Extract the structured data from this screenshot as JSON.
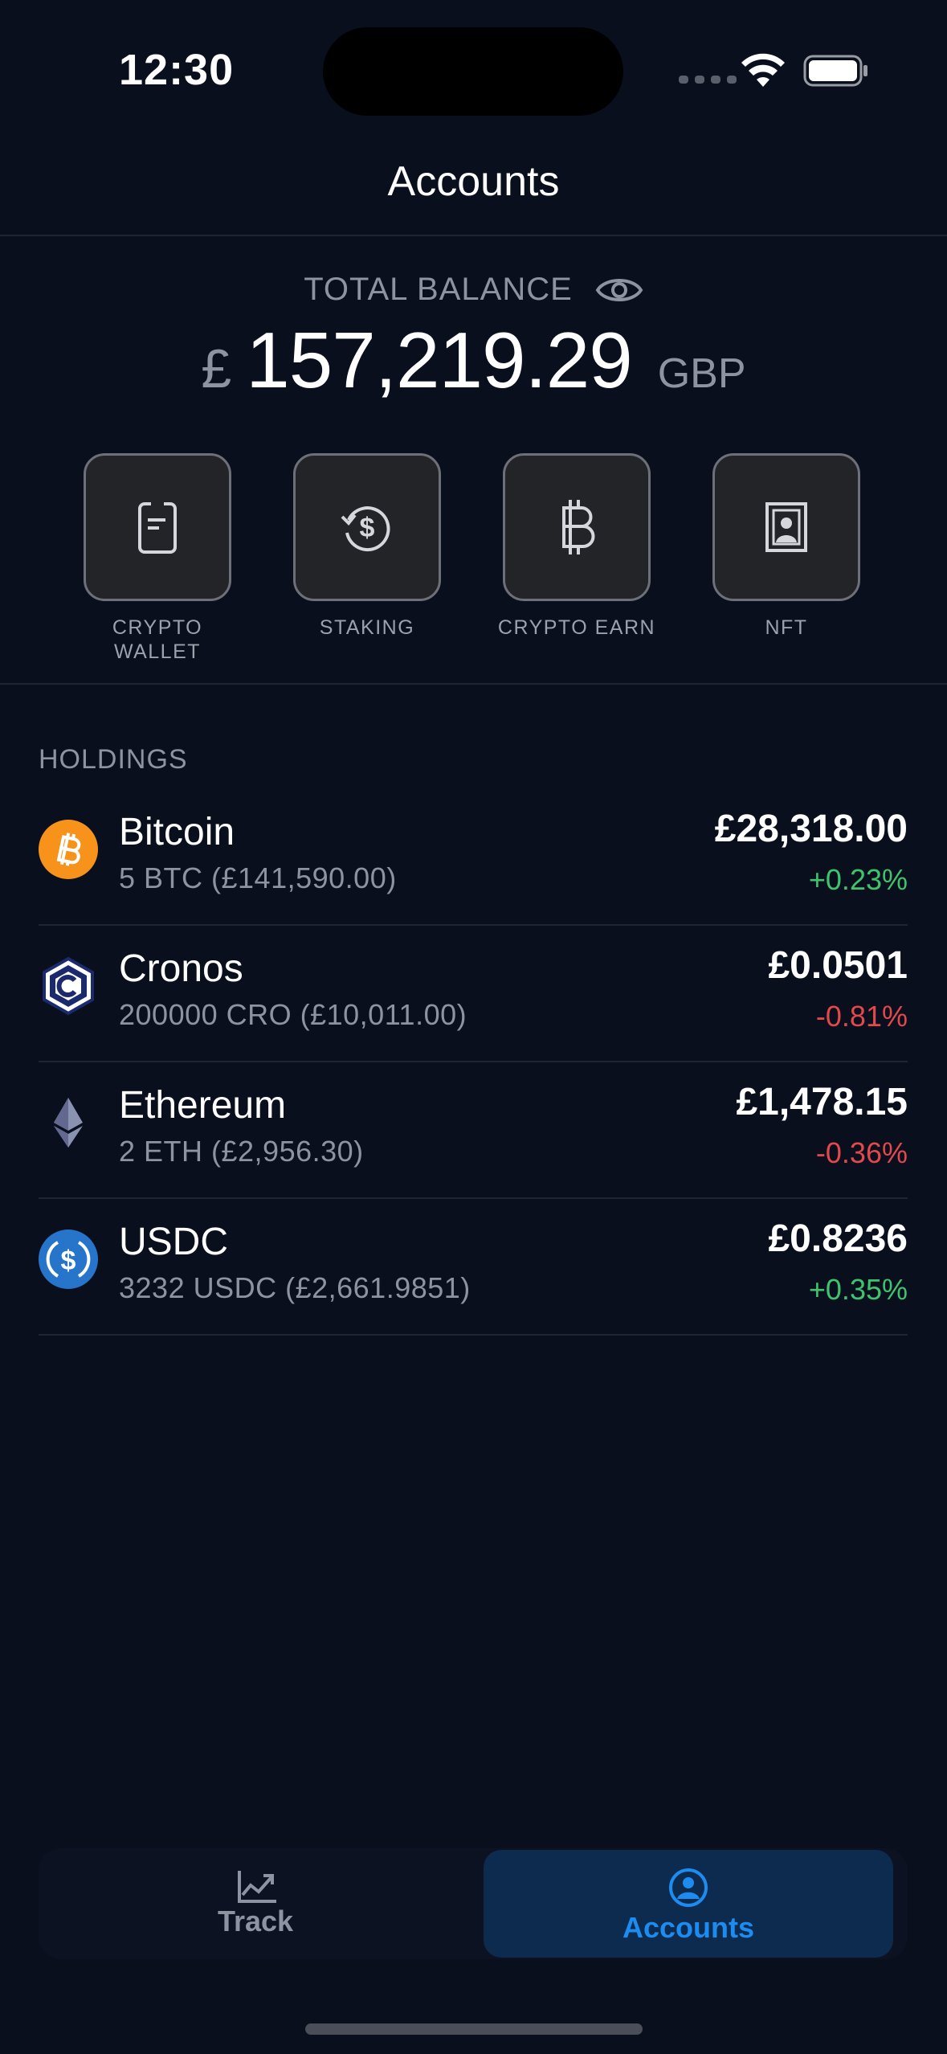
{
  "status_bar": {
    "time": "12:30"
  },
  "header": {
    "title": "Accounts"
  },
  "balance": {
    "label": "TOTAL BALANCE",
    "currency_symbol": "£",
    "amount": "157,219.29",
    "currency_code": "GBP",
    "visibility_icon": "eye-icon"
  },
  "actions": [
    {
      "label": "CRYPTO WALLET",
      "icon": "wallet-icon"
    },
    {
      "label": "STAKING",
      "icon": "staking-icon"
    },
    {
      "label": "CRYPTO EARN",
      "icon": "bitcoin-icon"
    },
    {
      "label": "NFT",
      "icon": "nft-portrait-icon"
    }
  ],
  "holdings": {
    "title": "HOLDINGS",
    "items": [
      {
        "name": "Bitcoin",
        "sub": "5 BTC (£141,590.00)",
        "price": "£28,318.00",
        "change": "+0.23%",
        "direction": "up",
        "icon": "bitcoin-coin-icon",
        "icon_color": "#f7931a"
      },
      {
        "name": "Cronos",
        "sub": "200000 CRO (£10,011.00)",
        "price": "£0.0501",
        "change": "-0.81%",
        "direction": "down",
        "icon": "cronos-coin-icon",
        "icon_color": "#1a2a6c"
      },
      {
        "name": "Ethereum",
        "sub": "2 ETH (£2,956.30)",
        "price": "£1,478.15",
        "change": "-0.36%",
        "direction": "down",
        "icon": "ethereum-coin-icon",
        "icon_color": "#8a92b2"
      },
      {
        "name": "USDC",
        "sub": "3232 USDC (£2,661.9851)",
        "price": "£0.8236",
        "change": "+0.35%",
        "direction": "up",
        "icon": "usdc-coin-icon",
        "icon_color": "#2775ca"
      }
    ]
  },
  "tab_bar": {
    "tabs": [
      {
        "label": "Track",
        "icon": "chart-trend-icon",
        "active": false
      },
      {
        "label": "Accounts",
        "icon": "account-circle-icon",
        "active": true
      }
    ]
  },
  "colors": {
    "background": "#0a0f1e",
    "positive": "#3ec46d",
    "negative": "#e2484c",
    "accent": "#1d8cf0"
  }
}
